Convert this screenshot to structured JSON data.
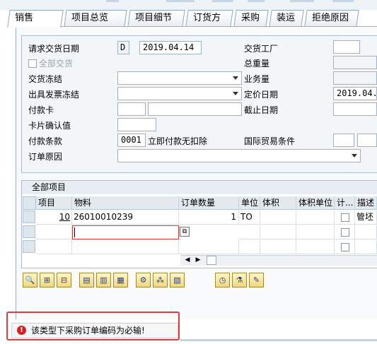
{
  "tabs": [
    {
      "label": "销售",
      "active": true
    },
    {
      "label": "项目总览",
      "active": false
    },
    {
      "label": "项目细节",
      "active": false
    },
    {
      "label": "订货方",
      "active": false
    },
    {
      "label": "采购",
      "active": false
    },
    {
      "label": "装运",
      "active": false
    },
    {
      "label": "拒绝原因",
      "active": false
    }
  ],
  "form": {
    "req_delivery_date_label": "请求交货日期",
    "req_delivery_date_type": "D",
    "req_delivery_date_value": "2019.04.14",
    "complete_delivery_label": "全部交货",
    "delivery_block_label": "交货冻结",
    "billing_block_label": "出具发票冻结",
    "payment_card_label": "付款卡",
    "card_verif_label": "卡片确认值",
    "payment_terms_label": "付款条款",
    "payment_terms_code": "0001",
    "payment_terms_desc": "立即付款无扣除",
    "order_reason_label": "订单原因",
    "plant_label": "交货工厂",
    "total_weight_label": "总重量",
    "volume_label": "业务量",
    "pricing_date_label": "定价日期",
    "pricing_date_value": "2019.04.",
    "cutoff_date_label": "截止日期",
    "incoterms_label": "国际贸易条件"
  },
  "items_table": {
    "title": "全部项目",
    "columns": [
      "项目",
      "物料",
      "订单数量",
      "单位",
      "体积",
      "体积单位",
      "计...",
      "描述"
    ],
    "rows": [
      {
        "item": "10",
        "material": "26010010239",
        "qty": "1",
        "unit": "TO",
        "desc": "管坯"
      },
      {
        "item": "",
        "material": "",
        "qty": "",
        "unit": "",
        "desc": ""
      },
      {
        "item": "",
        "material": "",
        "qty": "",
        "unit": "",
        "desc": ""
      }
    ]
  },
  "toolbar_icons": [
    "details-icon",
    "insert-row-icon",
    "delete-row-icon",
    "select-all-icon",
    "deselect-icon",
    "block-icon",
    "config-icon",
    "structure-icon",
    "table-settings-icon",
    "reschedule-icon",
    "batch-icon",
    "notes-icon"
  ],
  "message": {
    "type": "error",
    "text": "该类型下采购订单编码为必输!"
  },
  "colors": {
    "error": "#d61f1f",
    "highlight_border": "#e23b3b"
  }
}
